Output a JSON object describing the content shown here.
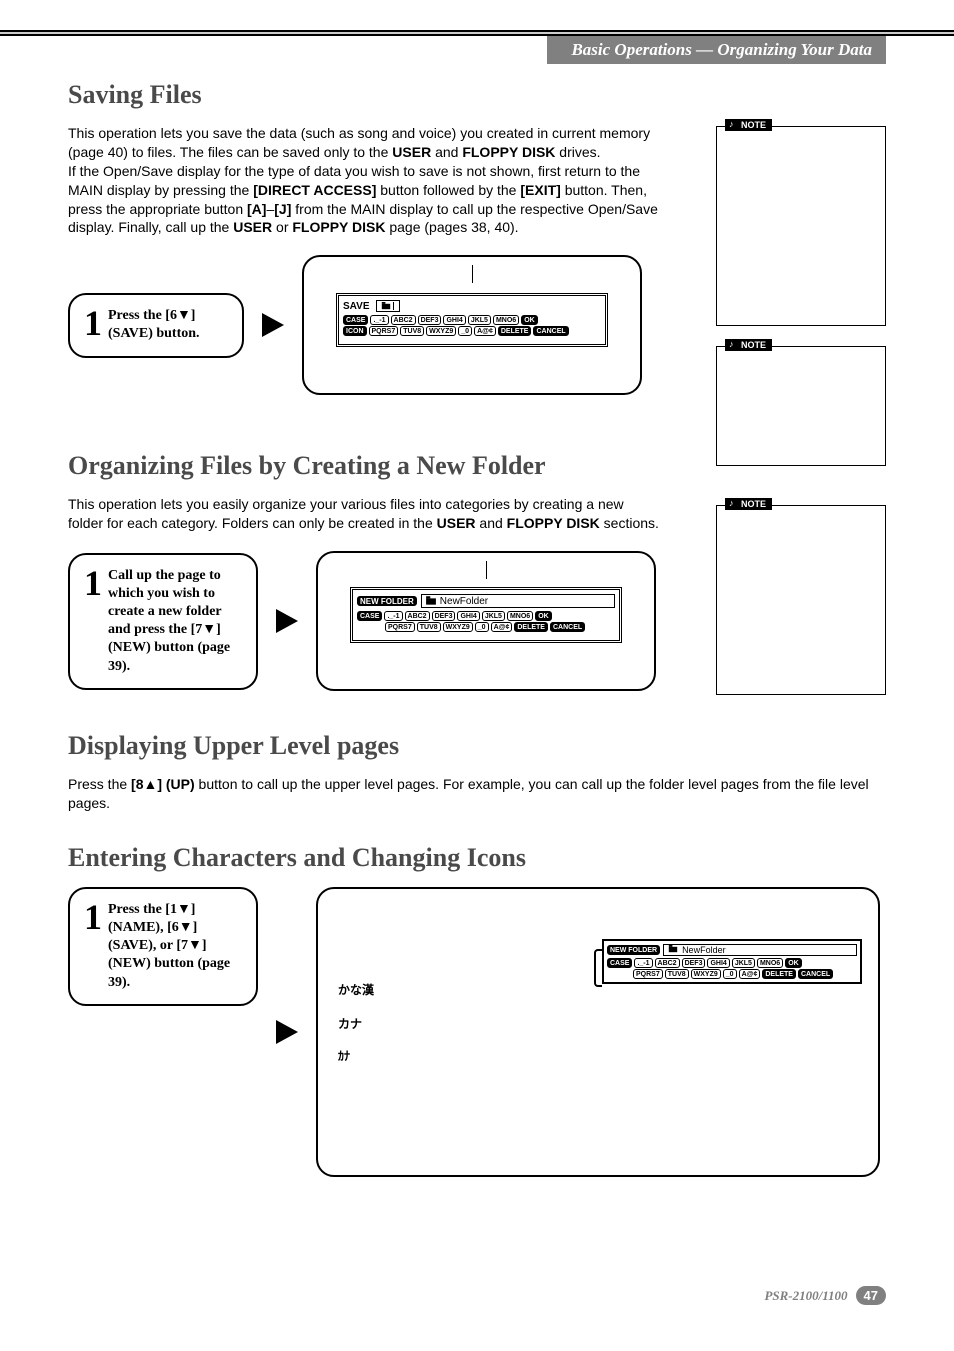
{
  "header": {
    "section_title": "Basic Operations — Organizing Your Data"
  },
  "saving_files": {
    "title": "Saving Files",
    "para": "This operation lets you save the data (such as song and voice) you created in current memory (page 40) to files. The files can be saved only to the USER and FLOPPY DISK drives.\nIf the Open/Save display for the type of data you wish to save is not shown, first return to the MAIN display by pressing the [DIRECT ACCESS] button followed by the [EXIT] button. Then, press the appropriate button [A]–[J] from the MAIN display to call up the respective Open/Save display. Finally, call up the USER or FLOPPY DISK page (pages 38, 40).",
    "bold_terms": [
      "USER",
      "FLOPPY DISK",
      "[DIRECT ACCESS]",
      "[EXIT]",
      "[A]",
      "[J]",
      "USER",
      "FLOPPY DISK"
    ],
    "step_num": "1",
    "step_text": "Press the [6▼] (SAVE) button."
  },
  "organizing": {
    "title": "Organizing Files by Creating a New Folder",
    "para": "This operation lets you easily organize your various files into categories by creating a new folder for each category. Folders can only be created in the USER and FLOPPY DISK sections.",
    "step_num": "1",
    "step_text": "Call up the page to which you wish to create a new folder and press the [7▼] (NEW) button (page 39)."
  },
  "displaying": {
    "title": "Displaying Upper Level pages",
    "para": "Press the [8▲] (UP) button to call up the upper level pages. For example, you can call up the folder level pages from the file level pages."
  },
  "entering": {
    "title": "Entering Characters and Changing Icons",
    "step_num": "1",
    "step_text": "Press the [1▼] (NAME), [6▼] (SAVE), or [7▼] (NEW) button (page 39).",
    "jp_items": [
      "かな漢",
      "カナ",
      "ｶﾅ"
    ]
  },
  "lcd": {
    "save_title": "SAVE",
    "newfolder_title": "NEW FOLDER",
    "newfolder_name": "NewFolder",
    "buttons_row1_left": [
      "CASE",
      "ICON"
    ],
    "buttons_row1": [
      "._-1",
      "ABC2",
      "DEF3",
      "GHI4",
      "JKL5",
      "MNO6",
      "OK"
    ],
    "buttons_row2": [
      "PQRS7",
      "TUV8",
      "WXYZ9",
      "_0",
      "A@¢",
      "DELETE",
      "CANCEL"
    ]
  },
  "notes": {
    "label": "NOTE"
  },
  "footer": {
    "model": "PSR-2100/1100",
    "page": "47"
  }
}
